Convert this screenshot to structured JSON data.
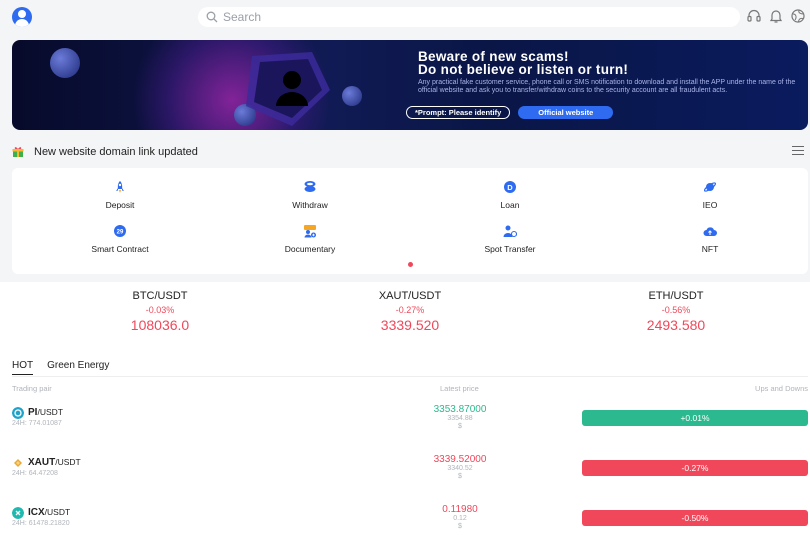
{
  "header": {
    "search_placeholder": "Search"
  },
  "banner": {
    "title_line1": "Beware of new scams!",
    "title_line2": "Do not believe or listen or turn!",
    "body": "Any practical fake customer service, phone call or SMS notification to download and install the APP under the name of the official website and ask you to transfer/withdraw coins to the security account are all fraudulent acts.",
    "prompt": "*Prompt: Please identify",
    "official": "Official website"
  },
  "notice": {
    "text": "New website domain link updated"
  },
  "quick_actions": [
    {
      "label": "Deposit",
      "icon": "rocket-icon"
    },
    {
      "label": "Withdraw",
      "icon": "stack-icon"
    },
    {
      "label": "Loan",
      "icon": "loan-coin-icon"
    },
    {
      "label": "IEO",
      "icon": "planet-icon"
    },
    {
      "label": "Smart Contract",
      "icon": "contract-icon"
    },
    {
      "label": "Documentary",
      "icon": "users-icon"
    },
    {
      "label": "Spot Transfer",
      "icon": "transfer-user-icon"
    },
    {
      "label": "NFT",
      "icon": "cloud-upload-icon"
    }
  ],
  "tickers": [
    {
      "pair": "BTC/USDT",
      "change": "-0.03%",
      "price": "108036.0"
    },
    {
      "pair": "XAUT/USDT",
      "change": "-0.27%",
      "price": "3339.520"
    },
    {
      "pair": "ETH/USDT",
      "change": "-0.56%",
      "price": "2493.580"
    }
  ],
  "tabs": [
    "HOT",
    "Green Energy"
  ],
  "columns": {
    "pair": "Trading pair",
    "price": "Latest price",
    "change": "Ups and Downs"
  },
  "markets": [
    {
      "base": "PI",
      "quote": "/USDT",
      "volume": "24H: 774.01087",
      "price": "3353.87000",
      "price_sub": "3354.88",
      "currency": "$",
      "change": "+0.01%",
      "direction": "up"
    },
    {
      "base": "XAUT",
      "quote": "/USDT",
      "volume": "24H: 64.47208",
      "price": "3339.52000",
      "price_sub": "3340.52",
      "currency": "$",
      "change": "-0.27%",
      "direction": "down"
    },
    {
      "base": "ICX",
      "quote": "/USDT",
      "volume": "24H: 61478.21820",
      "price": "0.11980",
      "price_sub": "0.12",
      "currency": "$",
      "change": "-0.50%",
      "direction": "down"
    }
  ],
  "colors": {
    "up": "#2cb98f",
    "down": "#f0485a",
    "accent": "#2e6bf0"
  }
}
